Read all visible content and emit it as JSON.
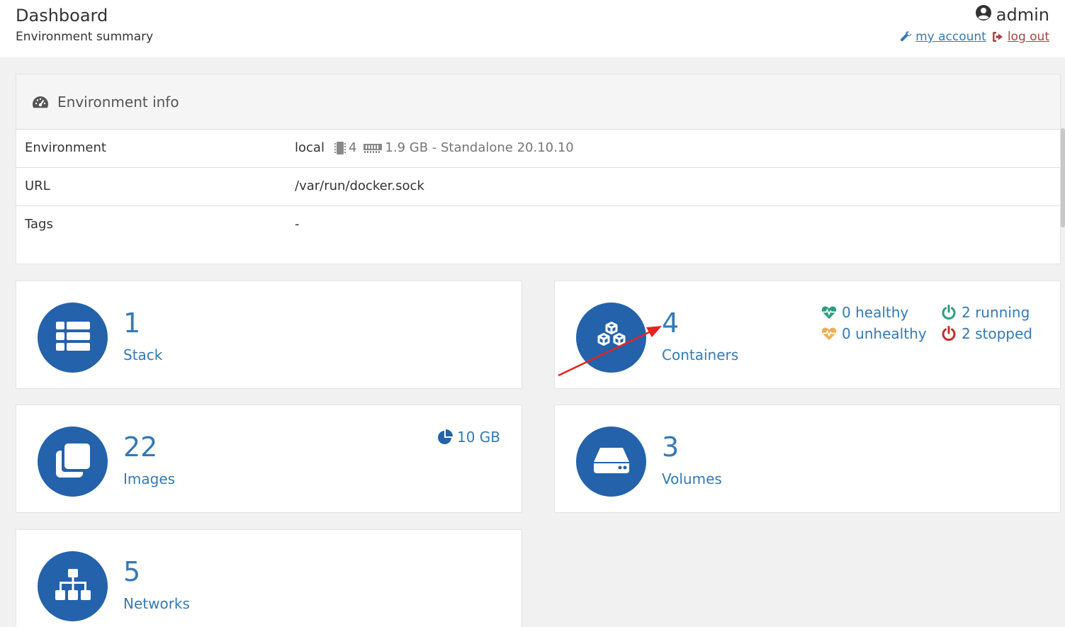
{
  "header": {
    "title": "Dashboard",
    "subtitle": "Environment summary",
    "user": "admin",
    "my_account": "my account",
    "log_out": "log out"
  },
  "env_info": {
    "title": "Environment info",
    "rows": [
      {
        "key": "Environment",
        "value": "local",
        "cpu": "4",
        "memory": "1.9 GB - Standalone 20.10.10"
      },
      {
        "key": "URL",
        "value": "/var/run/docker.sock"
      },
      {
        "key": "Tags",
        "value": "-"
      }
    ]
  },
  "widgets": {
    "stacks": {
      "count": "1",
      "label": "Stack",
      "icon": "th-list-icon"
    },
    "containers": {
      "count": "4",
      "label": "Containers",
      "icon": "cubes-icon",
      "healthy": "0 healthy",
      "unhealthy": "0 unhealthy",
      "running": "2 running",
      "stopped": "2 stopped"
    },
    "images": {
      "count": "22",
      "label": "Images",
      "size": "10 GB",
      "icon": "clone-icon"
    },
    "volumes": {
      "count": "3",
      "label": "Volumes",
      "icon": "hdd-icon"
    },
    "networks": {
      "count": "5",
      "label": "Networks",
      "icon": "sitemap-icon"
    }
  },
  "colors": {
    "accent": "#2462ab",
    "link": "#337ab7",
    "healthy": "#2a9d7f",
    "unhealthy": "#f0ad4e",
    "running": "#2a9d7f",
    "stopped": "#c12e2a",
    "logout": "#a94442",
    "annotation": "#e8231f"
  }
}
